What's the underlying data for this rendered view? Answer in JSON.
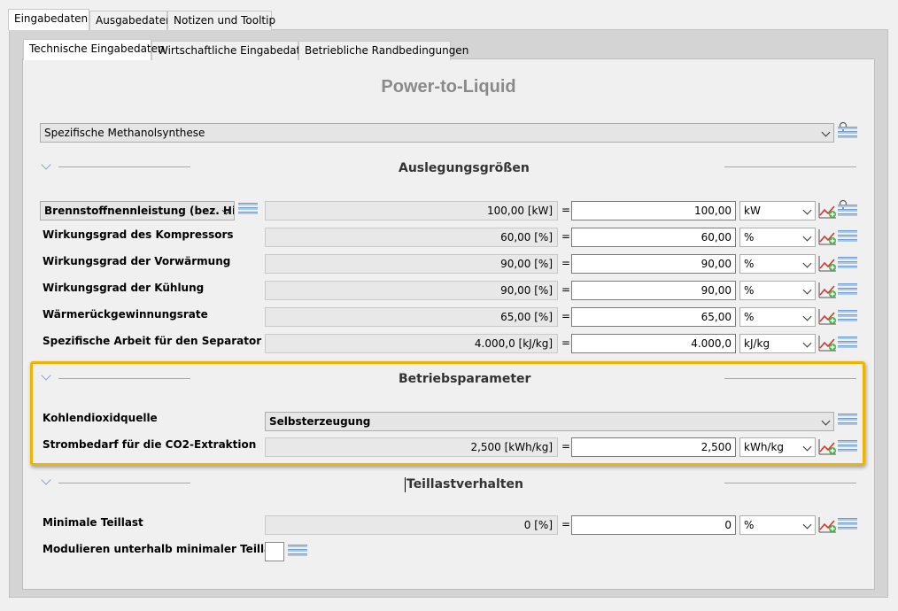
{
  "outer_tabs": [
    "Eingabedaten",
    "Ausgabedaten",
    "Notizen und Tooltip"
  ],
  "inner_tabs": [
    "Technische Eingabedaten",
    "Wirtschaftliche Eingabedaten",
    "Betriebliche Randbedingungen"
  ],
  "title": "Power-to-Liquid",
  "technology_select": "Spezifische Methanolsynthese",
  "sections": {
    "design": "Auslegungsgrößen",
    "operation": "Betriebsparameter",
    "partload": "Teillastverhalten"
  },
  "design_rows": [
    {
      "label": "Brennstoffnennleistung (bez. Hi/Hu)",
      "ro": "100,00 [kW]",
      "value": "100,00",
      "unit": "kW"
    },
    {
      "label": "Wirkungsgrad des Kompressors",
      "ro": "60,00 [%]",
      "value": "60,00",
      "unit": "%"
    },
    {
      "label": "Wirkungsgrad der Vorwärmung",
      "ro": "90,00 [%]",
      "value": "90,00",
      "unit": "%"
    },
    {
      "label": "Wirkungsgrad der Kühlung",
      "ro": "90,00 [%]",
      "value": "90,00",
      "unit": "%"
    },
    {
      "label": "Wärmerückgewinnungsrate",
      "ro": "65,00 [%]",
      "value": "65,00",
      "unit": "%"
    },
    {
      "label": "Spezifische Arbeit für den Separator",
      "ro": "4.000,0 [kJ/kg]",
      "value": "4.000,0",
      "unit": "kJ/kg"
    }
  ],
  "operation": {
    "co2_label": "Kohlendioxidquelle",
    "co2_value": "Selbsterzeugung",
    "power_label": "Strombedarf für die CO2-Extraktion",
    "power_ro": "2,500 [kWh/kg]",
    "power_value": "2,500",
    "power_unit": "kWh/kg"
  },
  "partload": {
    "min_label": "Minimale Teillast",
    "min_ro": "0 [%]",
    "min_value": "0",
    "min_unit": "%",
    "modulate_label": "Modulieren unterhalb minimaler Teillast"
  },
  "equals": "=",
  "icons": {
    "list": "list-icon",
    "chart": "chart-add-icon",
    "pin": "pin-icon",
    "chevron": "chevron-down-icon"
  },
  "colors": {
    "highlight": "#f0b400",
    "title": "#8a8a8a"
  }
}
